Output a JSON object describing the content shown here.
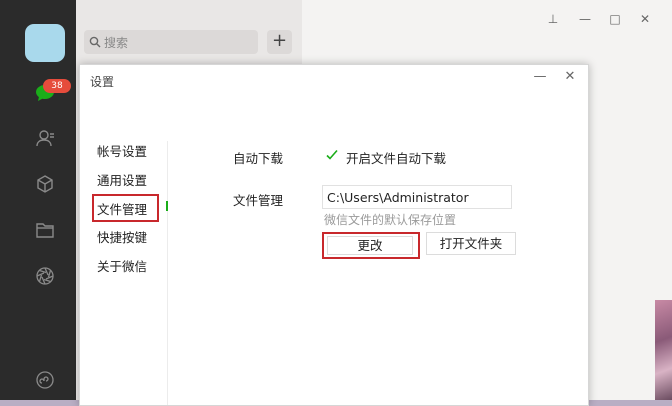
{
  "sidebar": {
    "unread_badge": "38",
    "icons": [
      "chat-icon",
      "contacts-icon",
      "favorites-cube-icon",
      "folder-icon",
      "moments-aperture-icon",
      "mini-program-icon"
    ]
  },
  "list": {
    "search_placeholder": "搜索",
    "add_label": "+"
  },
  "window_controls": {
    "pin": "⊥",
    "minimize": "—",
    "maximize": "□",
    "close": "✕"
  },
  "dialog": {
    "title": "设置",
    "minimize": "—",
    "close": "✕",
    "nav": [
      "帐号设置",
      "通用设置",
      "文件管理",
      "快捷按键",
      "关于微信"
    ],
    "active_nav": "文件管理",
    "auto_download": {
      "label": "自动下载",
      "checkbox_label": "开启文件自动下载",
      "checked": true
    },
    "file_management": {
      "label": "文件管理",
      "path": "C:\\Users\\Administrator",
      "hint": "微信文件的默认保存位置",
      "change_button": "更改",
      "open_folder_button": "打开文件夹"
    }
  },
  "colors": {
    "highlight_red": "#c8282c",
    "check_green": "#1aad19",
    "badge_red": "#e64c3c"
  }
}
